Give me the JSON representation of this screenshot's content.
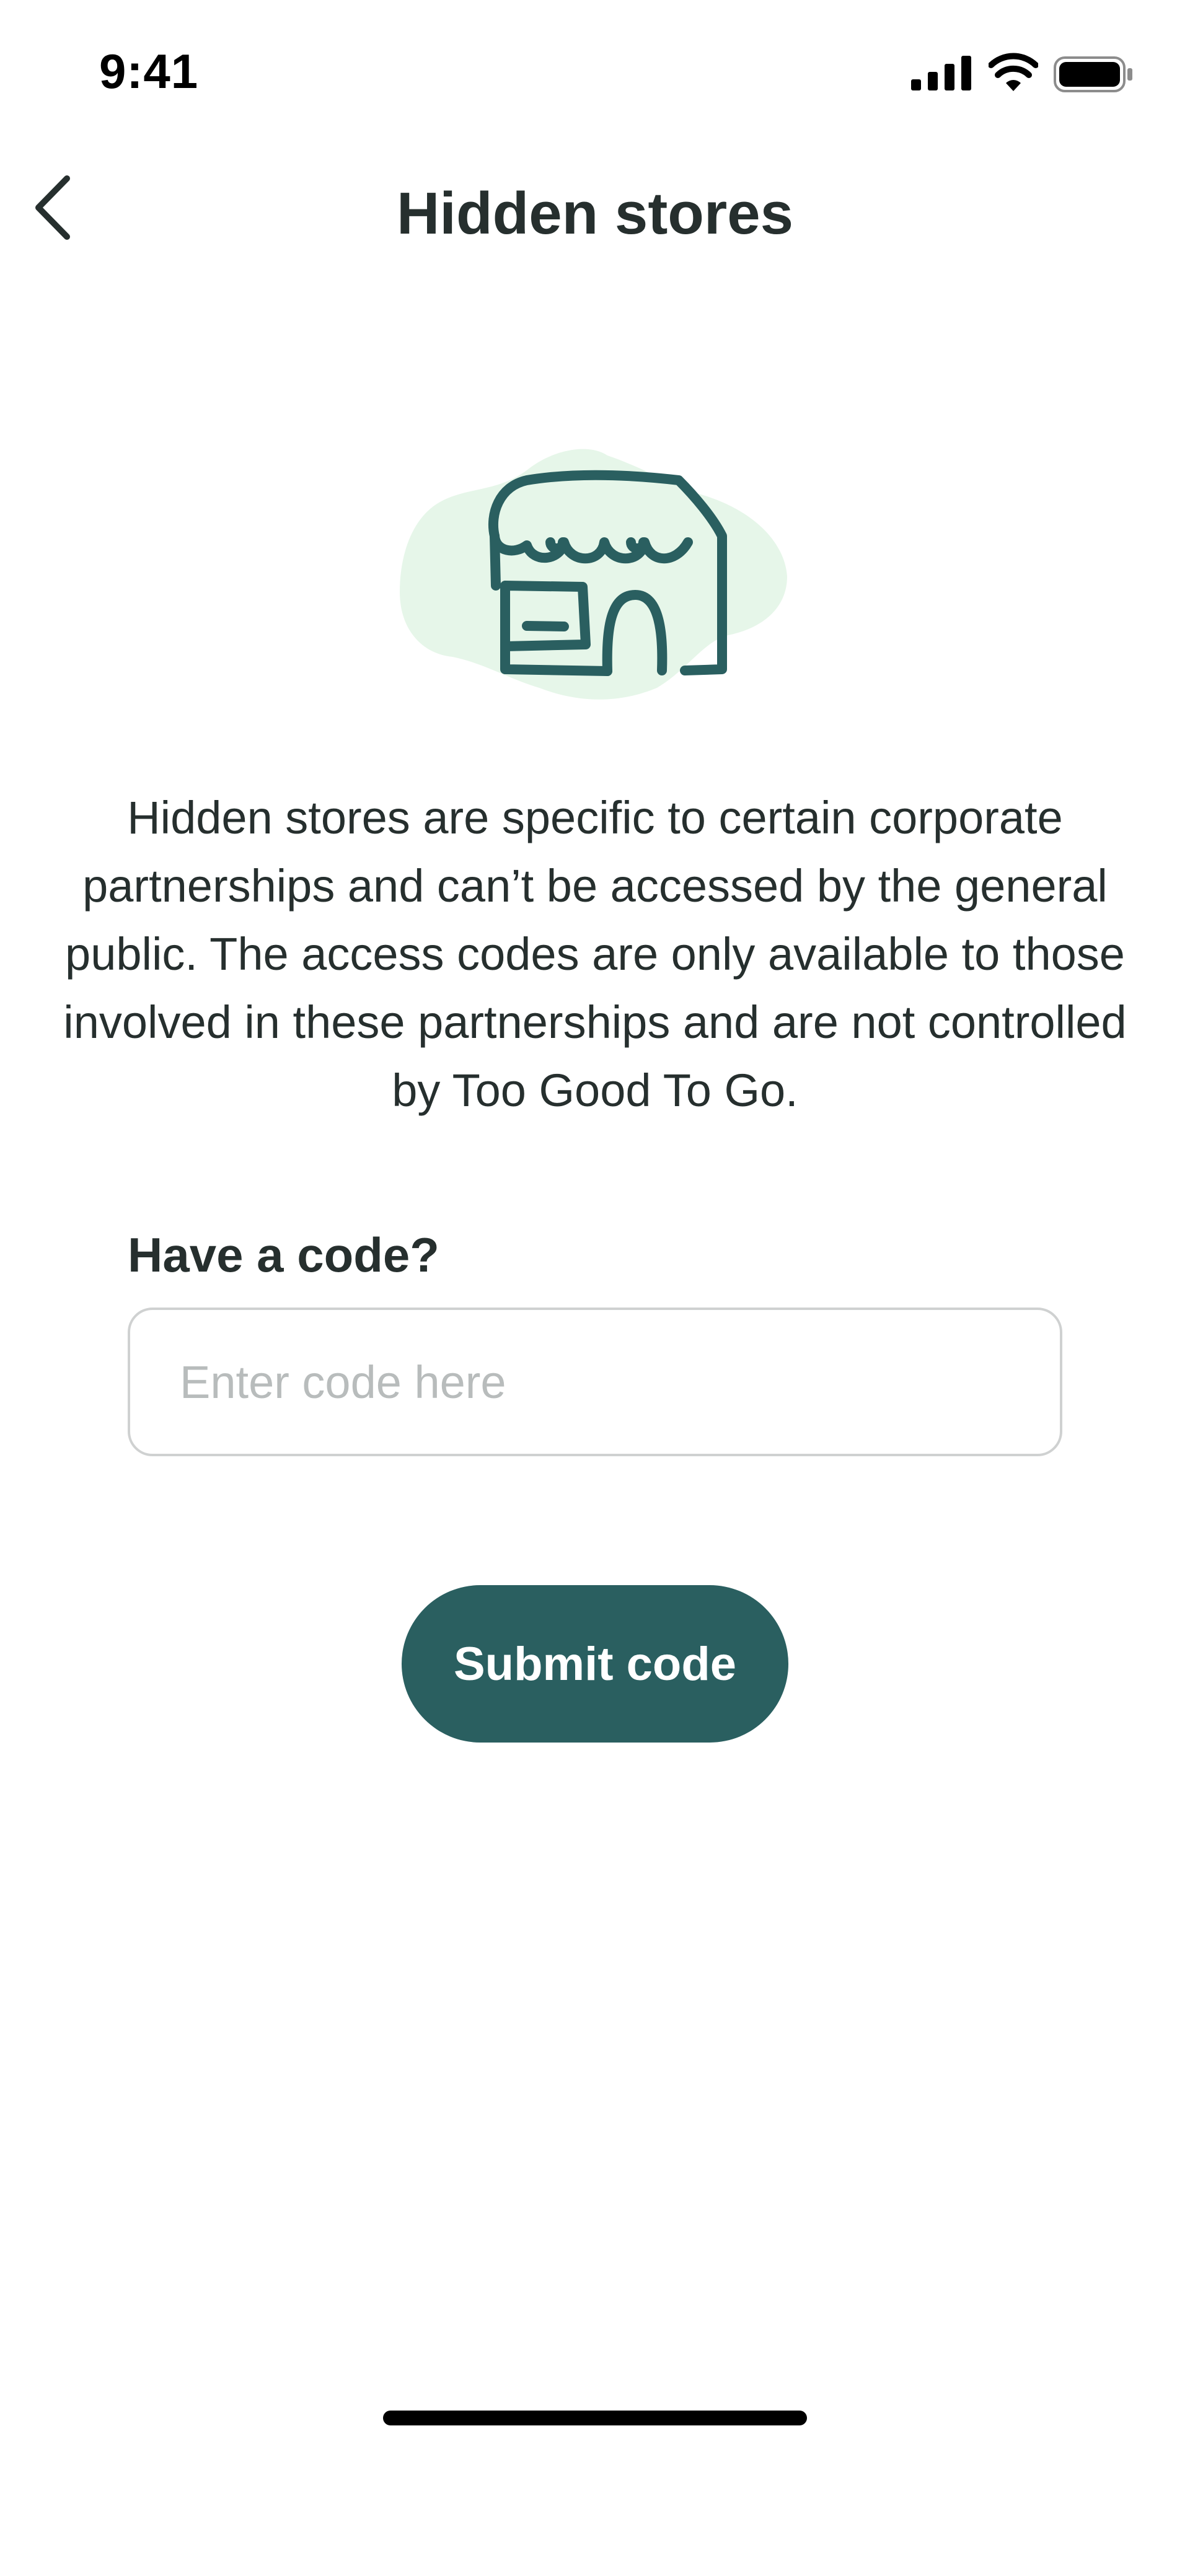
{
  "status_bar": {
    "time": "9:41",
    "icons": [
      "signal-icon",
      "wifi-icon",
      "battery-icon"
    ]
  },
  "nav": {
    "back_icon": "chevron-left-icon",
    "title": "Hidden stores"
  },
  "illustration": {
    "icon": "store-icon",
    "blob_color": "#e6f6e9",
    "stroke_color": "#2a5f60"
  },
  "description": "Hidden stores are specific to certain corporate partnerships and can’t be accessed by the general public. The access codes are only available to those involved in these partnerships and are not controlled by Too Good To Go.",
  "code_form": {
    "label": "Have a code?",
    "input_value": "",
    "input_placeholder": "Enter code here",
    "submit_label": "Submit code"
  },
  "colors": {
    "primary": "#2a5f60",
    "text": "#262f2e",
    "placeholder": "#b8bcbc",
    "input_border": "#cfd1d1"
  }
}
